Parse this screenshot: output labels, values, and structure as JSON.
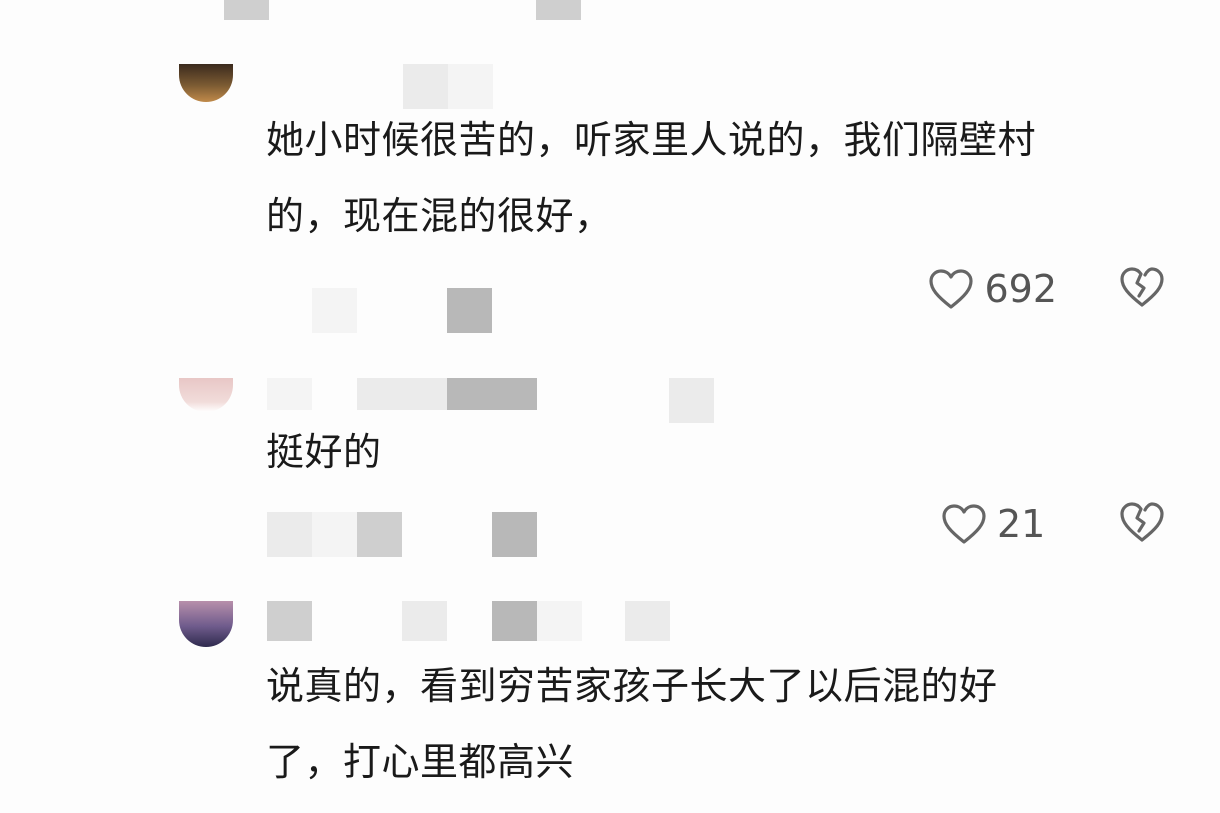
{
  "comments": [
    {
      "text_line1": "她小时候很苦的，听家里人说的，我们隔壁村",
      "text_line2": "的，现在混的很好，",
      "like_count": "692",
      "icons": {
        "like": "heart-outline-icon",
        "dislike": "broken-heart-icon"
      }
    },
    {
      "text_line1": "挺好的",
      "like_count": "21",
      "icons": {
        "like": "heart-outline-icon",
        "dislike": "broken-heart-icon"
      }
    },
    {
      "text_line1": "说真的，看到穷苦家孩子长大了以后混的好",
      "text_line2": "了，打心里都高兴"
    }
  ],
  "colors": {
    "text": "#1a1a1a",
    "icon": "#666666",
    "count": "#555555",
    "background": "#fdfdfd"
  }
}
